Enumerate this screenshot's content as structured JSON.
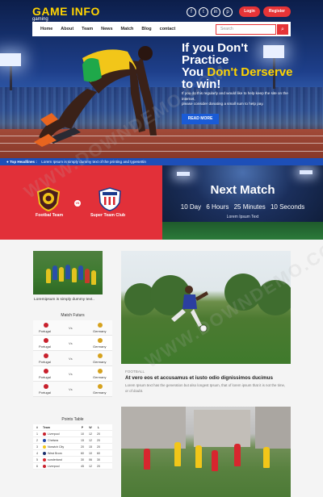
{
  "header": {
    "logo_main": "GAME INFO",
    "logo_sub": "gaming",
    "social": [
      {
        "icon": "facebook-icon",
        "glyph": "f"
      },
      {
        "icon": "twitter-icon",
        "glyph": "t"
      },
      {
        "icon": "linkedin-icon",
        "glyph": "in"
      },
      {
        "icon": "pinterest-icon",
        "glyph": "p"
      }
    ],
    "login_label": "Login",
    "register_label": "Register"
  },
  "nav": {
    "items": [
      "Home",
      "About",
      "Team",
      "News",
      "Match",
      "Blog",
      "contact"
    ],
    "search_placeholder": "Search",
    "search_icon_glyph": "⌕"
  },
  "hero": {
    "line1": "If you Don't",
    "line2": "Practice",
    "line3_a": "You ",
    "line3_b": "Don't Derserve",
    "line4": "to win!",
    "body_line1": "If you do this regularly and would like to help keep the site on the",
    "body_line2": "internet,",
    "body_line3": "please consider donating a small sum to help pay.",
    "button_label": "READ MORE"
  },
  "ticker": {
    "label": "Top Headlines :",
    "text": "Lorem Ipsum is simply dummy text of the printing and typesettin"
  },
  "match": {
    "vs_label": "VS",
    "team_a": "Footbal Team",
    "team_b": "Super Team Club",
    "next_title": "Next Match",
    "countdown": [
      "10 Day",
      "6 Hours",
      "25 Minutes",
      "10 Seconds"
    ],
    "subtitle": "Lorem Ipsum Text"
  },
  "sidebar": {
    "caption": "Loremipsum is simply dummy text..",
    "fixtures_heading": "Match Futurs",
    "vs_label": "Vs",
    "fixtures": [
      {
        "home": "Portugal",
        "away": "Germany"
      },
      {
        "home": "Portugal",
        "away": "Germany"
      },
      {
        "home": "Portugal",
        "away": "Germany"
      },
      {
        "home": "Portugal",
        "away": "Germany"
      },
      {
        "home": "Portugal",
        "away": "Germany"
      }
    ],
    "points_heading": "Points Table",
    "points_columns": [
      "#",
      "Team",
      "P",
      "W",
      "L"
    ],
    "points_rows": [
      {
        "no": "1",
        "team": "Liverpool",
        "p": "10",
        "w": "12",
        "l": "20"
      },
      {
        "no": "2",
        "team": "Chelsea",
        "p": "15",
        "w": "12",
        "l": "20"
      },
      {
        "no": "3",
        "team": "Norwich City",
        "p": "20",
        "w": "15",
        "l": "20"
      },
      {
        "no": "4",
        "team": "West Brom",
        "p": "60",
        "w": "10",
        "l": "60"
      },
      {
        "no": "5",
        "team": "sunderland",
        "p": "30",
        "w": "06",
        "l": "30"
      },
      {
        "no": "6",
        "team": "Liverpool",
        "p": "45",
        "w": "12",
        "l": "20"
      }
    ]
  },
  "article": {
    "tag": "FOOTBALL",
    "title": "At vero eos et accusamus et iusto odio dignissimos ducimus",
    "body": "Lorem Ipsum text has the generation but also longest Ipsum, that of lorem ipsum that it is not the time, or of doubt."
  },
  "colors": {
    "accent_red": "#e23039",
    "brand_yellow": "#ffd400",
    "brand_blue": "#1a5bd6"
  }
}
